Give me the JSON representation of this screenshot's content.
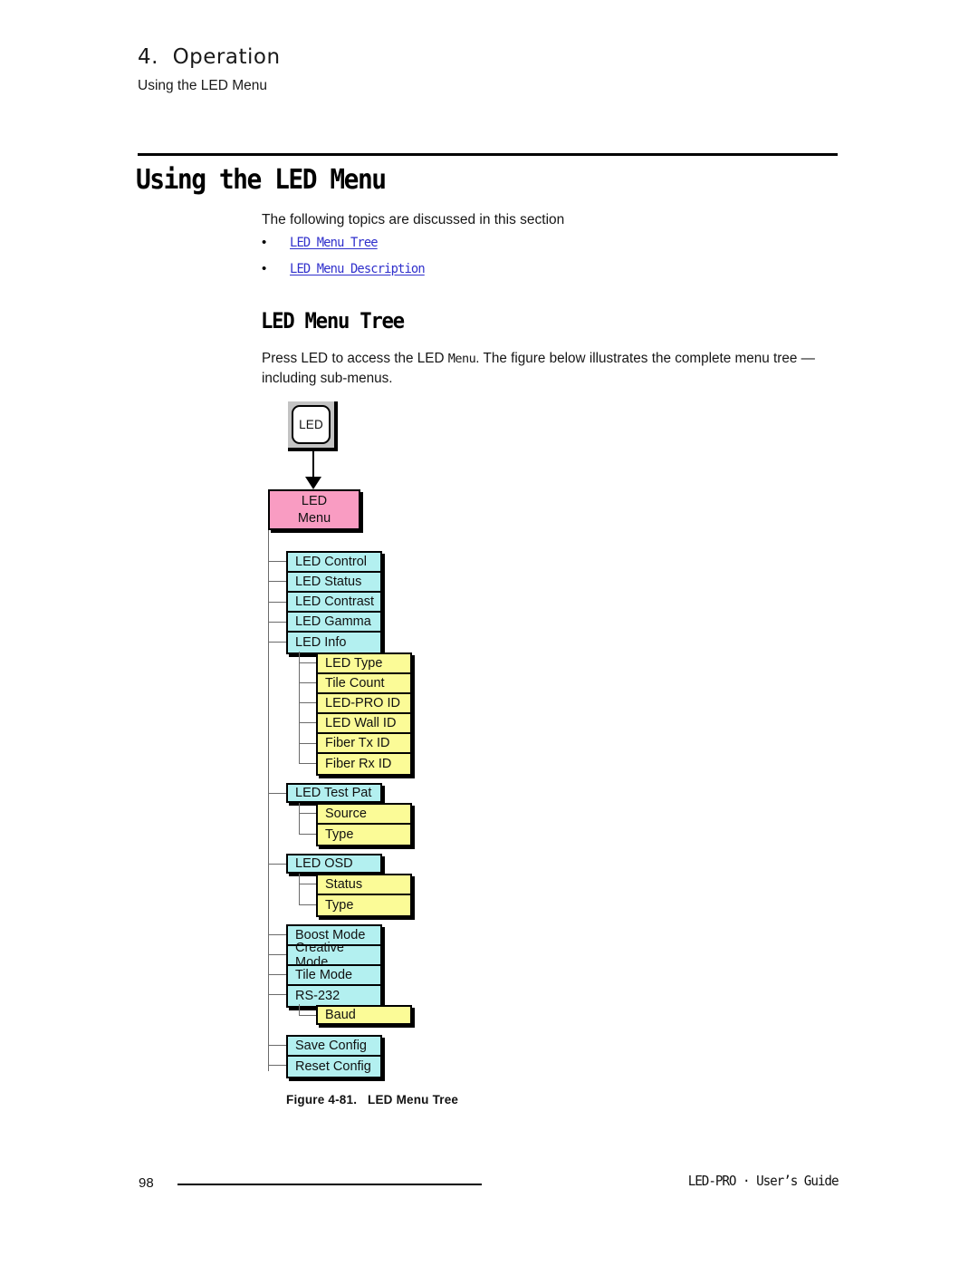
{
  "header": {
    "chapter": "4.  Operation",
    "subtitle": "Using the LED Menu"
  },
  "page_title": "Using the LED Menu",
  "intro": {
    "line": "The following topics are discussed in this section",
    "bullet_glyph": "•",
    "topics": [
      {
        "label": "LED Menu Tree"
      },
      {
        "label": "LED Menu Description"
      }
    ],
    "link_color": "#3030cc"
  },
  "section": {
    "title": "LED Menu Tree",
    "paragraph_part1": "Press LED to access the LED ",
    "paragraph_mono": "Menu",
    "paragraph_part2": ".  The figure below illustrates the complete menu tree — including sub-menus."
  },
  "figure": {
    "caption": "Figure 4-81.   LED Menu Tree",
    "key_button": {
      "label": "LED"
    },
    "root": {
      "line1": "LED",
      "line2": "Menu",
      "color": "#f99cc2"
    },
    "colors": {
      "cyan": "#b3f0f0",
      "yellow": "#fbfb97",
      "pink": "#f99cc2",
      "line": "#6b6b6b",
      "border": "#000000"
    },
    "groups": [
      {
        "name": "main-menu-group-1",
        "color": "cyan",
        "items": [
          {
            "label": "LED Control"
          },
          {
            "label": "LED Status"
          },
          {
            "label": "LED Contrast"
          },
          {
            "label": "LED Gamma"
          },
          {
            "label": "LED Info"
          }
        ]
      },
      {
        "name": "led-info-submenu",
        "color": "yellow",
        "items": [
          {
            "label": "LED Type"
          },
          {
            "label": "Tile Count"
          },
          {
            "label": "LED-PRO ID"
          },
          {
            "label": "LED Wall ID"
          },
          {
            "label": "Fiber Tx ID"
          },
          {
            "label": "Fiber Rx ID"
          }
        ]
      },
      {
        "name": "led-test-pat-item",
        "color": "cyan",
        "items": [
          {
            "label": "LED Test Pat"
          }
        ]
      },
      {
        "name": "led-test-pat-submenu",
        "color": "yellow",
        "items": [
          {
            "label": "Source"
          },
          {
            "label": "Type"
          }
        ]
      },
      {
        "name": "led-osd-item",
        "color": "cyan",
        "items": [
          {
            "label": "LED OSD"
          }
        ]
      },
      {
        "name": "led-osd-submenu",
        "color": "yellow",
        "items": [
          {
            "label": "Status"
          },
          {
            "label": "Type"
          }
        ]
      },
      {
        "name": "main-menu-group-2",
        "color": "cyan",
        "items": [
          {
            "label": "Boost Mode"
          },
          {
            "label": "Creative Mode"
          },
          {
            "label": "Tile Mode"
          },
          {
            "label": "RS-232"
          }
        ]
      },
      {
        "name": "rs232-submenu",
        "color": "yellow",
        "items": [
          {
            "label": "Baud"
          }
        ]
      },
      {
        "name": "main-menu-group-3",
        "color": "cyan",
        "items": [
          {
            "label": "Save Config"
          },
          {
            "label": "Reset Config"
          }
        ]
      }
    ]
  },
  "footer": {
    "page_number": "98",
    "guide": "LED-PRO · User’s Guide"
  }
}
